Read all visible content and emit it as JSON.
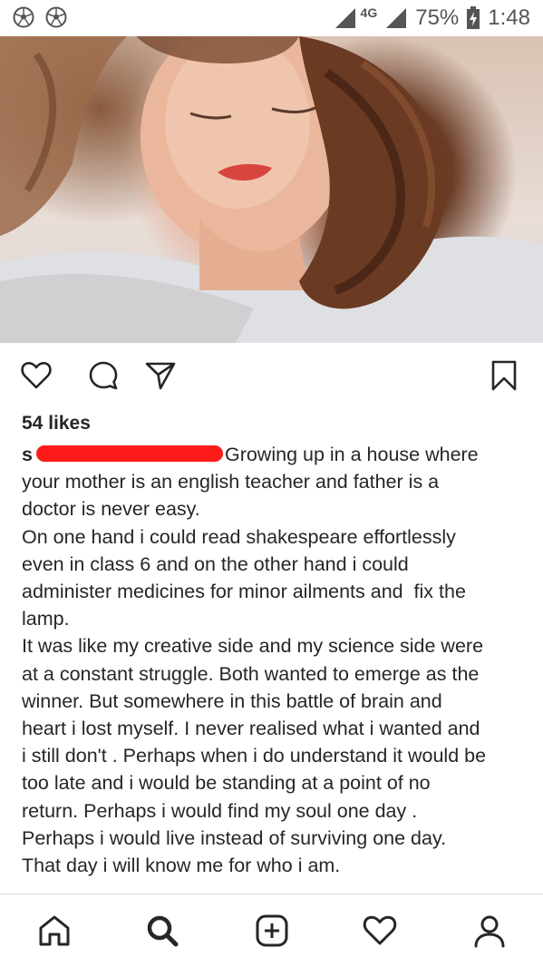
{
  "status_bar": {
    "network": "4G",
    "battery": "75%",
    "time": "1:48",
    "left_icons": [
      "soccer-ball-icon",
      "soccer-ball-icon"
    ]
  },
  "post": {
    "image": "portrait-photo",
    "likes": "54 likes",
    "username_visible": "s",
    "caption_lines": [
      "Growing up in a house where",
      "your mother is an english teacher and father is a",
      "doctor is never easy.",
      "On one hand i could read shakespeare effortlessly",
      "even in class 6 and on the other hand i could",
      "administer medicines for minor ailments and  fix the",
      "lamp.",
      "It was like my creative side and my science side were",
      "at a constant struggle. Both wanted to emerge as the",
      "winner. But somewhere in this battle of brain and",
      "heart i lost myself. I never realised what i wanted and",
      "i still don't . Perhaps when i do understand it would be",
      "too late and i would be standing at a point of no",
      "return. Perhaps i would find my soul one day .",
      "Perhaps i would live instead of surviving one day.",
      "That day i will know me for who i am."
    ],
    "actions": [
      "heart-icon",
      "comment-icon",
      "share-icon",
      "bookmark-icon"
    ]
  },
  "bottom_nav": [
    "home-icon",
    "search-icon",
    "add-post-icon",
    "activity-heart-icon",
    "profile-icon"
  ],
  "colors": {
    "redaction": "#ff1a1a",
    "text": "#262626",
    "divider": "#dbdbdb"
  }
}
